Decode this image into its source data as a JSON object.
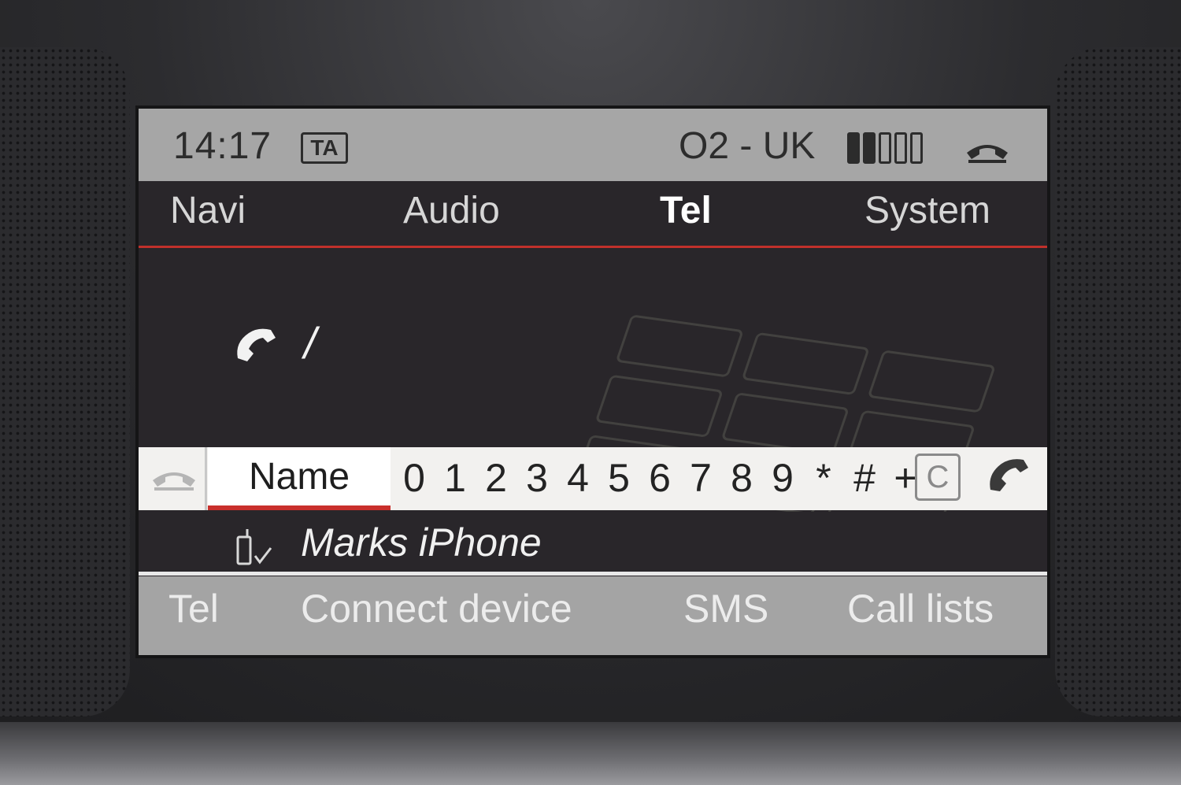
{
  "status": {
    "time": "14:17",
    "ta_badge": "TA",
    "carrier": "O2 - UK",
    "signal_bars_filled": 2,
    "signal_bars_total": 5
  },
  "main_menu": {
    "items": [
      {
        "label": "Navi"
      },
      {
        "label": "Audio"
      },
      {
        "label": "Tel",
        "active": true
      },
      {
        "label": "System"
      }
    ]
  },
  "dial": {
    "entry": "/"
  },
  "speller": {
    "name_label": "Name",
    "characters": [
      "0",
      "1",
      "2",
      "3",
      "4",
      "5",
      "6",
      "7",
      "8",
      "9",
      "*",
      "#",
      "+"
    ],
    "clear_label": "C"
  },
  "device": {
    "name": "Marks iPhone"
  },
  "softkeys": {
    "items": [
      {
        "label": "Tel"
      },
      {
        "label": "Connect device"
      },
      {
        "label": "SMS"
      },
      {
        "label": "Call lists"
      }
    ]
  },
  "colors": {
    "accent_red": "#c9302c",
    "statusbar": "#a6a6a6",
    "screen_bg": "#29262a"
  }
}
